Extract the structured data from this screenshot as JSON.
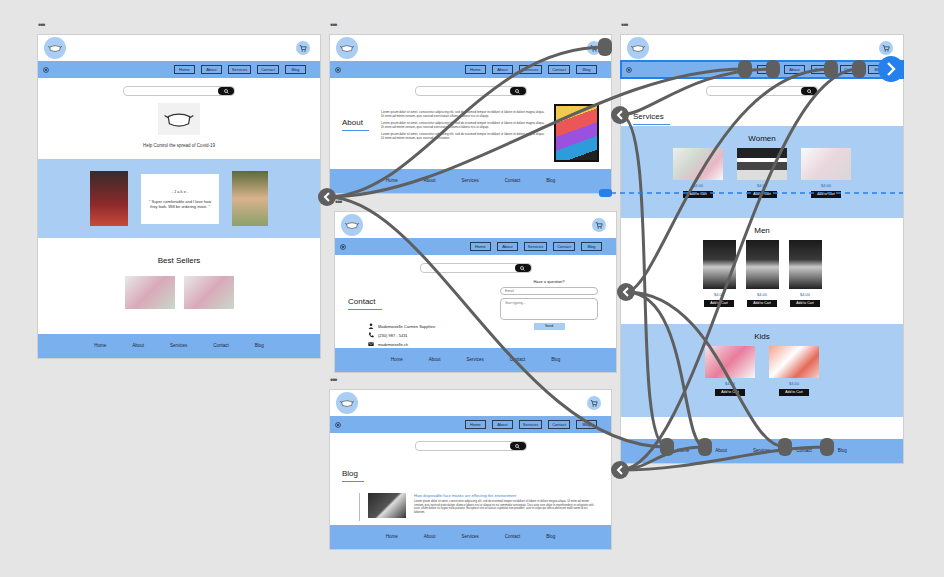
{
  "home": {
    "menu": "•••",
    "nav": [
      "Home",
      "About",
      "Services",
      "Contact",
      "Blog"
    ],
    "tagline": "Help Control the spread of Covid-19",
    "testimonial": {
      "author": "- J a k e -",
      "quote": "\" Super comfortable and I love how they look. Will be ordering more. \""
    },
    "best_sellers_title": "Best Sellers",
    "footer": [
      "Home",
      "About",
      "Services",
      "Contact",
      "Blog"
    ]
  },
  "about": {
    "menu": "•••",
    "nav": [
      "Home",
      "About",
      "Services",
      "Contact",
      "Blog"
    ],
    "title": "About",
    "paragraphs": [
      "Lorem ipsum dolor sit amet, consectetur adipiscing elit, sed do eiusmod tempor incididunt ut labore et dolore magna aliqua. Ut enim ad minim veniam, quis nostrud exercitation ullamco laboris nisi ut aliquip.",
      "Lorem ipsum dolor sit amet, consectetur adipiscing elit, sed do eiusmod tempor incididunt ut labore et dolore magna aliqua. Ut enim ad minim veniam, quis nostrud exercitation ullamco laboris nisi ut aliquip.",
      "Lorem ipsum dolor sit amet, consectetur adipiscing elit, sed do eiusmod tempor incididunt ut labore et dolore magna aliqua. Ut enim ad minim veniam, quis nostrud exercitation."
    ],
    "footer": [
      "Home",
      "About",
      "Services",
      "Contact",
      "Blog"
    ]
  },
  "contact": {
    "menu": "•••",
    "nav": [
      "Home",
      "About",
      "Services",
      "Contact",
      "Blog"
    ],
    "title": "Contact",
    "details": [
      {
        "kind": "person",
        "text": "Mademoiselle Carmen Sapphire"
      },
      {
        "kind": "phone",
        "text": "(230) 987 - 5431"
      },
      {
        "kind": "email",
        "text": "mademoiselle.ch"
      }
    ],
    "form": {
      "title": "Have a question?",
      "email_placeholder": "Email",
      "message_placeholder": "Start typing...",
      "send": "Send"
    },
    "footer": [
      "Home",
      "About",
      "Services",
      "Contact",
      "Blog"
    ]
  },
  "blog": {
    "menu": "•••",
    "nav": [
      "Home",
      "About",
      "Services",
      "Contact",
      "Blog"
    ],
    "title": "Blog",
    "post": {
      "title": "How disposable face masks are effecting the environment",
      "body": "Lorem ipsum dolor sit amet, consectetur adipiscing elit, sed do eiusmod tempor incididunt ut labore et dolore magna aliqua. Ut enim ad minim veniam, quis nostrud exercitation ullamco laboris nisi ut aliquip ex ea commodo consequat. Duis aute irure dolor in reprehenderit in voluptate velit esse cillum dolore eu fugiat nulla pariatur. Excepteur sint occaecat cupidatat non proident, sunt in culpa qui officia deserunt mollit anim id est laborum."
    },
    "footer": [
      "Home",
      "About",
      "Services",
      "Contact",
      "Blog"
    ]
  },
  "services": {
    "menu": "•••",
    "nav": [
      "Home",
      "About",
      "Services",
      "Contact",
      "Blog"
    ],
    "nav_selected": true,
    "title": "Services",
    "categories": [
      {
        "title": "Women",
        "kind": "square",
        "products": [
          {
            "price": "$4.00",
            "button": "Add to Cart"
          },
          {
            "price": "$4.00",
            "button": "Add to Cart"
          },
          {
            "price": "$4.00",
            "button": "Add to Cart"
          }
        ]
      },
      {
        "title": "Men",
        "kind": "tall",
        "products": [
          {
            "price": "$4.00",
            "button": "Add to Cart"
          },
          {
            "price": "$4.00",
            "button": "Add to Cart"
          },
          {
            "price": "$4.00",
            "button": "Add to Cart"
          }
        ]
      },
      {
        "title": "Kids",
        "kind": "square",
        "products": [
          {
            "price": "$4.00",
            "button": "Add to Cart"
          },
          {
            "price": "$4.00",
            "button": "Add to Cart"
          }
        ]
      }
    ],
    "footer": [
      "Home",
      "About",
      "Services",
      "Contact",
      "Blog"
    ]
  }
}
